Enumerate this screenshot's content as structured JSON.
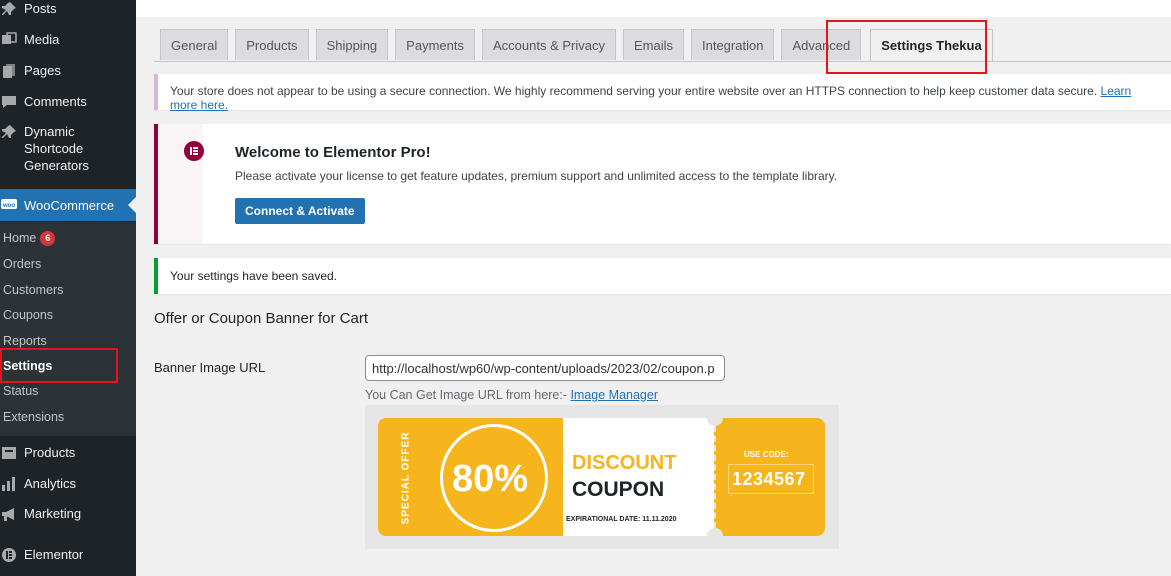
{
  "sidebar": {
    "items": [
      {
        "label": "Posts",
        "icon": "pin-icon"
      },
      {
        "label": "Media",
        "icon": "media-icon"
      },
      {
        "label": "Pages",
        "icon": "pages-icon"
      },
      {
        "label": "Comments",
        "icon": "comment-icon"
      },
      {
        "label": "Dynamic Shortcode Generators",
        "icon": "pin-icon"
      },
      {
        "label": "WooCommerce",
        "icon": "woo-icon"
      },
      {
        "label": "Products",
        "icon": "products-icon"
      },
      {
        "label": "Analytics",
        "icon": "analytics-icon"
      },
      {
        "label": "Marketing",
        "icon": "megaphone-icon"
      },
      {
        "label": "Elementor",
        "icon": "elementor-icon"
      }
    ],
    "submenu": [
      {
        "label": "Home",
        "badge": "6"
      },
      {
        "label": "Orders"
      },
      {
        "label": "Customers"
      },
      {
        "label": "Coupons"
      },
      {
        "label": "Reports"
      },
      {
        "label": "Settings"
      },
      {
        "label": "Status"
      },
      {
        "label": "Extensions"
      }
    ]
  },
  "tabs": [
    "General",
    "Products",
    "Shipping",
    "Payments",
    "Accounts & Privacy",
    "Emails",
    "Integration",
    "Advanced",
    "Settings Thekua"
  ],
  "active_tab": "Settings Thekua",
  "notices": {
    "ssl_text": "Your store does not appear to be using a secure connection. We highly recommend serving your entire website over an HTTPS connection to help keep customer data secure.",
    "ssl_link": "Learn more here.",
    "elementor_title": "Welcome to Elementor Pro!",
    "elementor_desc": "Please activate your license to get feature updates, premium support and unlimited access to the template library.",
    "elementor_button": "Connect & Activate",
    "saved_text": "Your settings have been saved."
  },
  "form": {
    "section_title": "Offer or Coupon Banner for Cart",
    "field_label": "Banner Image URL",
    "field_value": "http://localhost/wp60/wp-content/uploads/2023/02/coupon.p",
    "help_prefix": "You Can Get Image URL from here:-",
    "help_link": "Image Manager"
  },
  "coupon": {
    "vertical_text": "SPECIAL OFFER",
    "percent": "80%",
    "discount": "DISCOUNT",
    "coupon": "COUPON",
    "date": "EXPIRATIONAL DATE: 11.11.2020",
    "use_code": "USE CODE:",
    "code": "1234567"
  },
  "colors": {
    "sidebar_bg": "#1d2327",
    "accent": "#2271b1",
    "highlight": "#e8121b",
    "coupon_yellow": "#f6b51c",
    "elementor": "#92003b",
    "success": "#00a32a"
  }
}
